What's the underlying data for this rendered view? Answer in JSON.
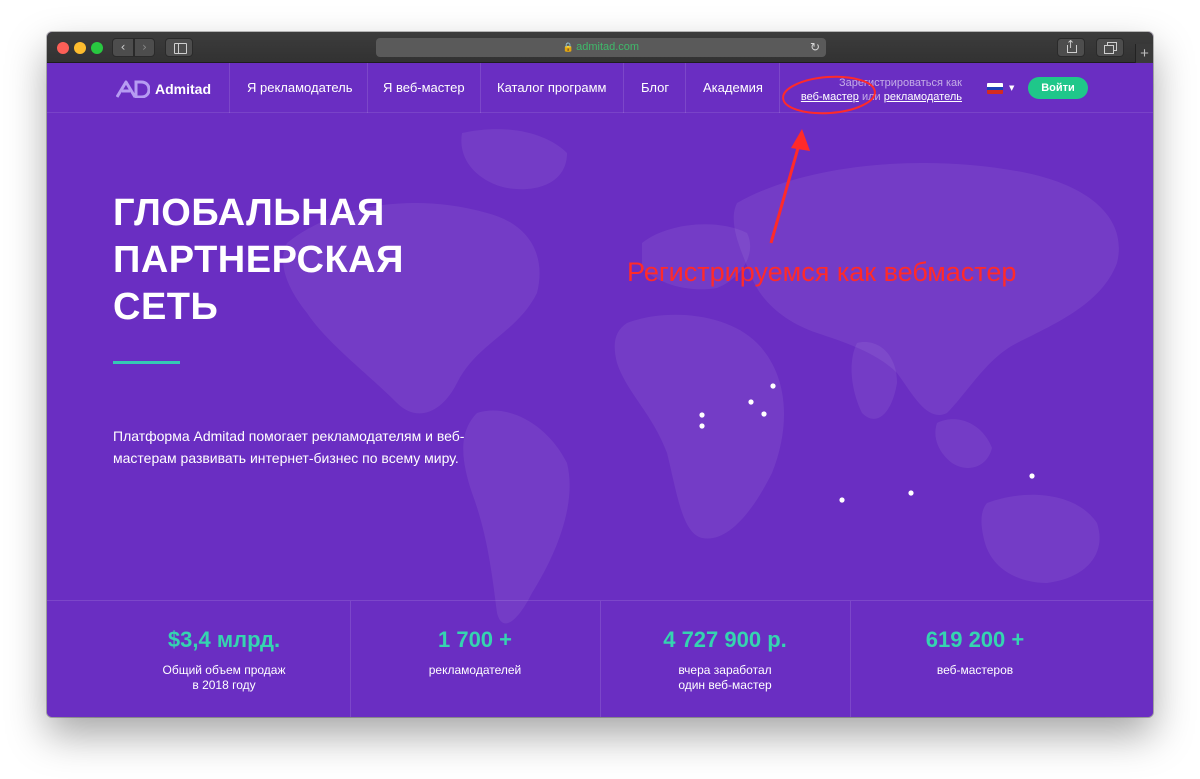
{
  "browser": {
    "url": "admitad.com",
    "back_glyph": "‹",
    "forward_glyph": "›",
    "reload_glyph": "↻",
    "plus_glyph": "+",
    "lock_glyph": "🔒"
  },
  "header": {
    "logo_text": "Admitad",
    "nav": [
      "Я рекламодатель",
      "Я веб-мастер",
      "Каталог программ",
      "Блог",
      "Академия"
    ],
    "register_prefix": "Зарегистрироваться как",
    "register_webmaster": "веб-мастер",
    "register_or": "или",
    "register_advertiser": "рекламодатель",
    "caret": "▼",
    "login_label": "Войти"
  },
  "hero": {
    "title_lines": [
      "ГЛОБАЛЬНАЯ",
      "ПАРТНЕРСКАЯ",
      "СЕТЬ"
    ],
    "description": "Платформа Admitad помогает рекламодателям и веб-мастерам развивать интернет-бизнес по всему миру."
  },
  "annotation": {
    "text": "Регистрируемся как вебмастер",
    "color": "#ff2a2a"
  },
  "stats": [
    {
      "value": "$3,4 млрд.",
      "label": "Общий объем продаж\nв 2018 году"
    },
    {
      "value": "1 700 +",
      "label": "рекламодателей"
    },
    {
      "value": "4 727 900 р.",
      "label": "вчера заработал\nодин веб-мастер"
    },
    {
      "value": "619 200 +",
      "label": "веб-мастеров"
    }
  ],
  "colors": {
    "background": "#6a2ec2",
    "accent_green": "#1fc78a",
    "stat_teal": "#35d4b0"
  }
}
